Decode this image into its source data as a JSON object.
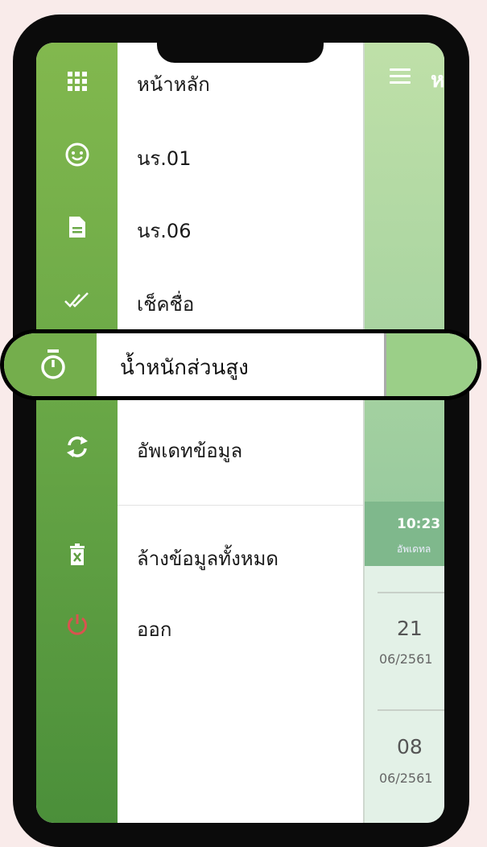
{
  "menu": {
    "items": [
      {
        "label": "หน้าหลัก",
        "icon": "grid-icon"
      },
      {
        "label": "นร.01",
        "icon": "face-icon"
      },
      {
        "label": "นร.06",
        "icon": "document-icon"
      },
      {
        "label": "เช็คชื่อ",
        "icon": "double-check-icon"
      },
      {
        "label": "น้ำหนักส่วนสูง",
        "icon": "stopwatch-icon"
      },
      {
        "label": "อัพเดทข้อมูล",
        "icon": "sync-icon"
      },
      {
        "label": "ล้างข้อมูลทั้งหมด",
        "icon": "trash-icon"
      },
      {
        "label": "ออก",
        "icon": "power-icon"
      }
    ]
  },
  "content": {
    "header_peek": "ห",
    "update_time": "10:23",
    "update_label": "อัพเดทล",
    "entries": [
      {
        "day": "21",
        "month": "06/2561"
      },
      {
        "day": "08",
        "month": "06/2561"
      }
    ]
  },
  "colors": {
    "rail_top": "#82b84e",
    "rail_bottom": "#4b8f3a",
    "power_icon": "#d9534f",
    "background": "#f9ebea"
  }
}
